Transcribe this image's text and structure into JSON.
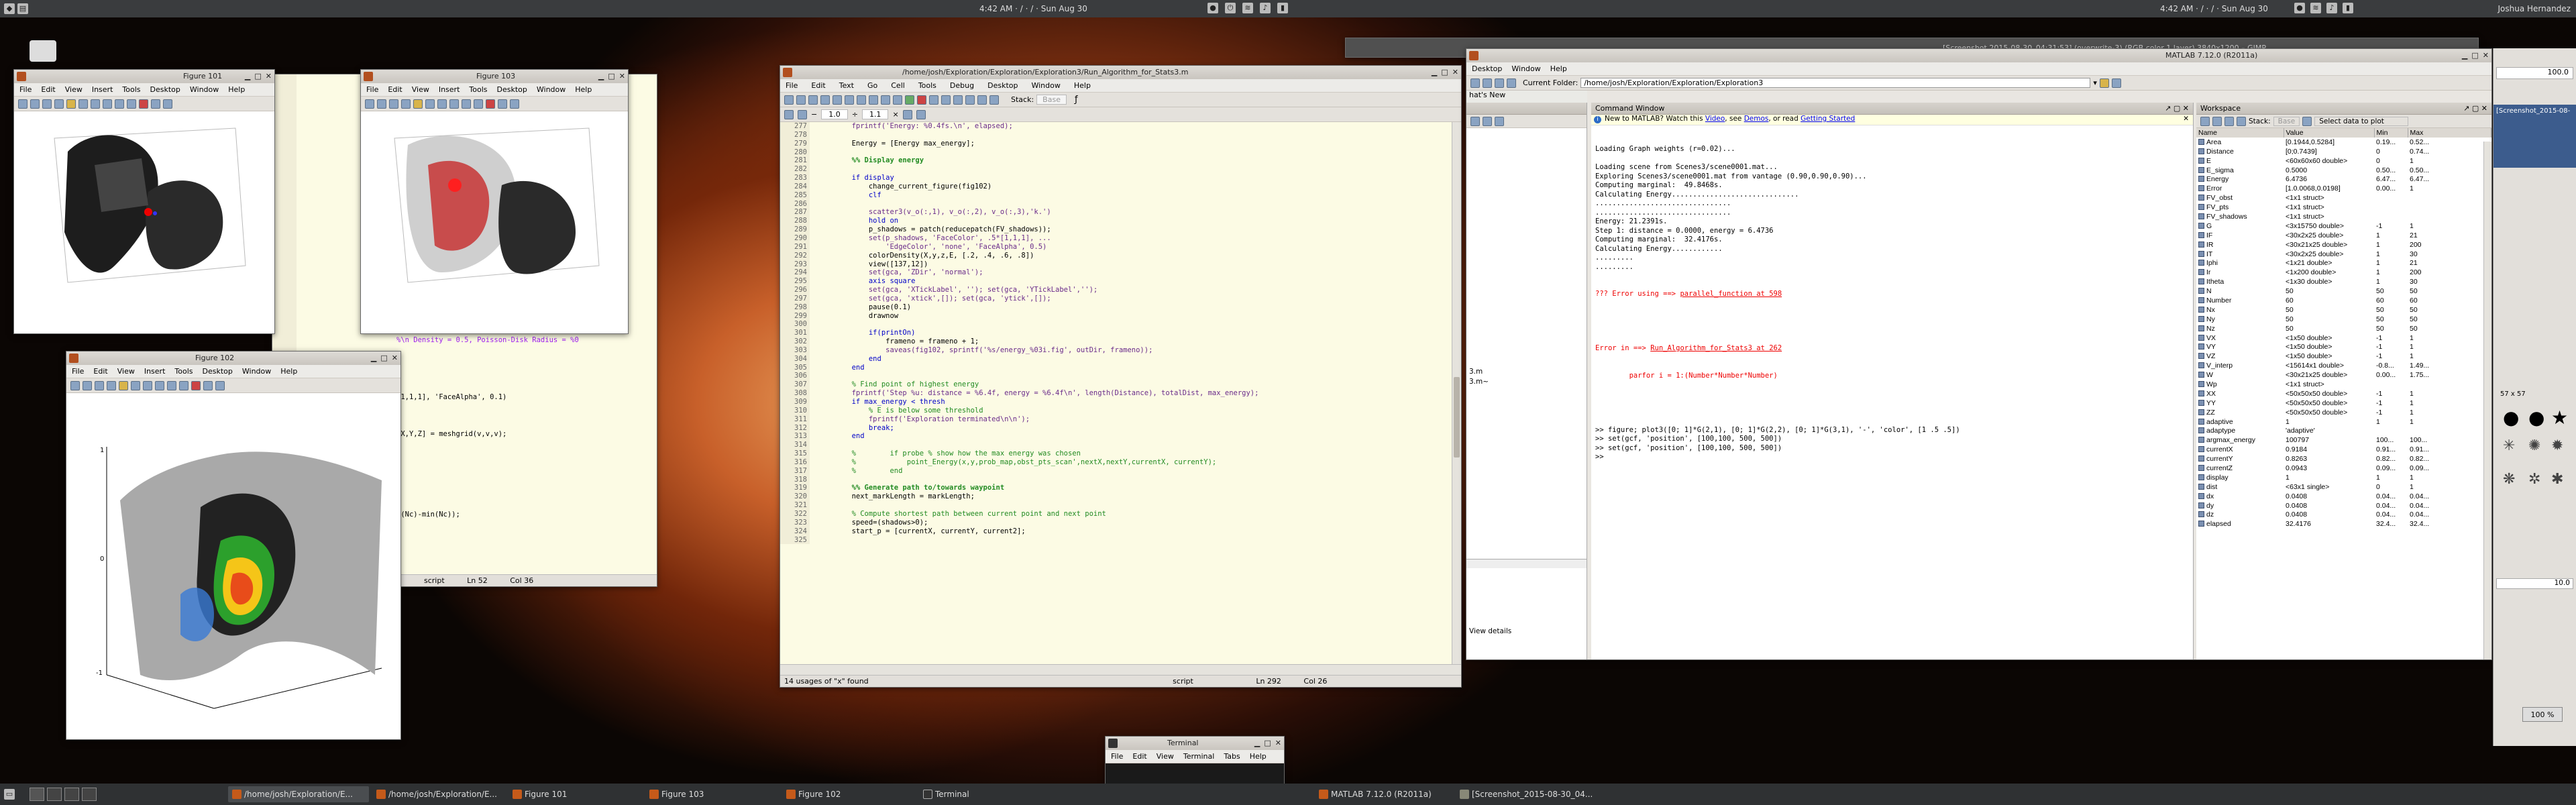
{
  "top_panel": {
    "clock_left": "4:42 AM · / · / · Sun Aug 30",
    "clock_right": "4:42 AM · / · / · Sun Aug 30",
    "user_name": "Joshua Hernandez"
  },
  "figure101": {
    "title": "Figure 101",
    "menu": [
      "File",
      "Edit",
      "View",
      "Insert",
      "Tools",
      "Desktop",
      "Window",
      "Help"
    ]
  },
  "figure103": {
    "title": "Figure 103",
    "menu": [
      "File",
      "Edit",
      "View",
      "Insert",
      "Tools",
      "Desktop",
      "Window",
      "Help"
    ]
  },
  "figure102": {
    "title": "Figure 102",
    "menu": [
      "File",
      "Edit",
      "View",
      "Insert",
      "Tools",
      "Desktop",
      "Window",
      "Help"
    ]
  },
  "editor_back": {
    "lines": [
      "%\\n Density = 0.5, Poisson-Disk Radius = %0",
      "[X,Y,Z] = meshgrid(v,v,v);",
      "[1,1,1], 'FaceAlpha', 0.1)",
      "x(Nc)-min(Nc));"
    ],
    "status_script": "script",
    "status_ln": "Ln  52",
    "status_col": "Col  36",
    "row_54": "54"
  },
  "editor": {
    "title": "/home/josh/Exploration/Exploration/Exploration3/Run_Algorithm_for_Stats3.m",
    "menu": [
      "File",
      "Edit",
      "Text",
      "Go",
      "Cell",
      "Tools",
      "Debug",
      "Desktop",
      "Window",
      "Help"
    ],
    "stack_label": "Stack:",
    "stack_value": "Base",
    "zoom_minus": "1.0",
    "zoom_plus": "1.1",
    "line_numbers": [
      "277",
      "278",
      "279",
      "280",
      "281",
      "282",
      "283",
      "284",
      "285",
      "286",
      "287",
      "288",
      "289",
      "290",
      "291",
      "292",
      "293",
      "294",
      "295",
      "296",
      "297",
      "298",
      "299",
      "300",
      "301",
      "302",
      "303",
      "304",
      "305",
      "306",
      "307",
      "308",
      "309",
      "310",
      "311",
      "312",
      "313",
      "314",
      "315",
      "316",
      "317",
      "318",
      "319",
      "320",
      "321",
      "322",
      "323",
      "324",
      "325"
    ],
    "code_lines": [
      "        fprintf('Energy: %0.4fs.\\n', elapsed);",
      "",
      "        Energy = [Energy max_energy];",
      "",
      "        %% Display energy",
      "",
      "        if display",
      "            change_current_figure(fig102)",
      "            clf",
      "",
      "            scatter3(v_o(:,1), v_o(:,2), v_o(:,3),'k.')",
      "            hold on",
      "            p_shadows = patch(reducepatch(FV_shadows));",
      "            set(p_shadows, 'FaceColor', .5*[1,1,1], ...",
      "                'EdgeColor', 'none', 'FaceAlpha', 0.5)",
      "            colorDensity(X,y,z,E, [.2, .4, .6, .8])",
      "            view([137,12])",
      "            set(gca, 'ZDir', 'normal');",
      "            axis square",
      "            set(gca, 'XTickLabel', ''); set(gca, 'YTickLabel','');",
      "            set(gca, 'xtick',[]); set(gca, 'ytick',[]);",
      "            pause(0.1)",
      "            drawnow",
      "",
      "            if(printOn)",
      "                frameno = frameno + 1;",
      "                saveas(fig102, sprintf('%s/energy_%03i.fig', outDir, frameno));",
      "            end",
      "        end",
      "",
      "        % Find point of highest energy",
      "        fprintf('Step %u: distance = %6.4f, energy = %6.4f\\n', length(Distance), totalDist, max_energy);",
      "        if max_energy < thresh",
      "            % E is below some threshold",
      "            fprintf('Exploration terminated\\n\\n');",
      "            break;",
      "        end",
      "",
      "        %        if probe % show how the max energy was chosen",
      "        %            point_Energy(x,y,prob_map,obst_pts_scan',nextX,nextY,currentX, currentY);",
      "        %        end",
      "",
      "        %% Generate path to/towards waypoint",
      "        next_markLength = markLength;",
      "",
      "        % Compute shortest path between current point and next point",
      "        speed=(shadows>0);",
      "        start_p = [currentX, currentY, current2];",
      ""
    ],
    "status_usage": "14 usages of \"x\" found",
    "status_script": "script",
    "status_ln": "Ln  292",
    "status_col": "Col  26"
  },
  "matlab": {
    "title": "MATLAB  7.12.0 (R2011a)",
    "menu": [
      "Desktop",
      "Window",
      "Help"
    ],
    "current_folder_label": "Current Folder:",
    "current_folder_value": "/home/josh/Exploration/Exploration/Exploration3",
    "whats_new": "hat's New",
    "cmd_window_title": "Command Window",
    "new_to_matlab_prefix": "New to MATLAB? Watch this ",
    "video_link": "Video",
    "see_text": ", see ",
    "demos_link": "Demos",
    "or_read": ", or read ",
    "getting_started_link": "Getting Started",
    "cmd_output": [
      "Loading Graph weights (r=0.02)...",
      "",
      "Loading scene from Scenes3/scene0001.mat...",
      "Exploring Scenes3/scene0001.mat from vantage (0.90,0.90,0.90)...",
      "Computing marginal:  49.8468s.",
      "Calculating Energy..............................",
      "................................",
      "................................",
      "Energy: 21.2391s.",
      "Step 1: distance = 0.0000, energy = 6.4736",
      "Computing marginal:  32.4176s.",
      "Calculating Energy............",
      ".........",
      "........."
    ],
    "err1_prefix": "??? Error using ==> ",
    "err1_link": "parallel_function at 598",
    "err2_prefix": "Error in ==> ",
    "err2_link": "Run_Algorithm_for_Stats3 at 262",
    "err2_code": "        parfor i = 1:(Number*Number*Number)",
    "cmd_after": [
      ">> figure; plot3([0; 1]*G(2,1), [0; 1]*G(2,2), [0; 1]*G(3,1), '-', 'color', [1 .5 .5])",
      ">> set(gcf, 'position', [100,100, 500, 500])",
      ">> set(gcf, 'position', [100,100, 500, 500])",
      ">>"
    ],
    "view_details": "View details",
    "side_items": [
      "3.m",
      "3.m~"
    ],
    "workspace_title": "Workspace",
    "workspace_toolbar": {
      "stack_label": "Stack:",
      "stack_value": "Base",
      "plot_select": "Select data to plot"
    },
    "workspace_columns": [
      "Name",
      "Value",
      "Min",
      "Max"
    ],
    "workspace_rows": [
      [
        "Area",
        "[0.1944,0.5284]",
        "0.19...",
        "0.52..."
      ],
      [
        "Distance",
        "[0;0.7439]",
        "0",
        "0.74..."
      ],
      [
        "E",
        "<60x60x60 double>",
        "0",
        "1"
      ],
      [
        "E_sigma",
        "0.5000",
        "0.50...",
        "0.50..."
      ],
      [
        "Energy",
        "6.4736",
        "6.47...",
        "6.47..."
      ],
      [
        "Error",
        "[1.0.0068,0.0198]",
        "0.00...",
        "1"
      ],
      [
        "FV_obst",
        "<1x1 struct>",
        "",
        ""
      ],
      [
        "FV_pts",
        "<1x1 struct>",
        "",
        ""
      ],
      [
        "FV_shadows",
        "<1x1 struct>",
        "",
        ""
      ],
      [
        "G",
        "<3x15750 double>",
        "-1",
        "1"
      ],
      [
        "IF",
        "<30x2x25 double>",
        "1",
        "21"
      ],
      [
        "IR",
        "<30x21x25 double>",
        "1",
        "200"
      ],
      [
        "IT",
        "<30x2x25 double>",
        "1",
        "30"
      ],
      [
        "Iphi",
        "<1x21 double>",
        "1",
        "21"
      ],
      [
        "Ir",
        "<1x200 double>",
        "1",
        "200"
      ],
      [
        "Itheta",
        "<1x30 double>",
        "1",
        "30"
      ],
      [
        "N",
        "50",
        "50",
        "50"
      ],
      [
        "Number",
        "60",
        "60",
        "60"
      ],
      [
        "Nx",
        "50",
        "50",
        "50"
      ],
      [
        "Ny",
        "50",
        "50",
        "50"
      ],
      [
        "Nz",
        "50",
        "50",
        "50"
      ],
      [
        "VX",
        "<1x50 double>",
        "-1",
        "1"
      ],
      [
        "VY",
        "<1x50 double>",
        "-1",
        "1"
      ],
      [
        "VZ",
        "<1x50 double>",
        "-1",
        "1"
      ],
      [
        "V_interp",
        "<15614x1 double>",
        "-0.8...",
        "1.49..."
      ],
      [
        "W",
        "<30x21x25 double>",
        "0.00...",
        "1.75..."
      ],
      [
        "Wp",
        "<1x1 struct>",
        "",
        ""
      ],
      [
        "XX",
        "<50x50x50 double>",
        "-1",
        "1"
      ],
      [
        "YY",
        "<50x50x50 double>",
        "-1",
        "1"
      ],
      [
        "ZZ",
        "<50x50x50 double>",
        "-1",
        "1"
      ],
      [
        "adaptive",
        "1",
        "1",
        "1"
      ],
      [
        "adaptype",
        "'adaptive'",
        "",
        ""
      ],
      [
        "argmax_energy",
        "100797",
        "100...",
        "100..."
      ],
      [
        "currentX",
        "0.9184",
        "0.91...",
        "0.91..."
      ],
      [
        "currentY",
        "0.8263",
        "0.82...",
        "0.82..."
      ],
      [
        "currentZ",
        "0.0943",
        "0.09...",
        "0.09..."
      ],
      [
        "display",
        "1",
        "1",
        "1"
      ],
      [
        "dist",
        "<63x1 single>",
        "0",
        "1"
      ],
      [
        "dx",
        "0.0408",
        "0.04...",
        "0.04..."
      ],
      [
        "dy",
        "0.0408",
        "0.04...",
        "0.04..."
      ],
      [
        "dz",
        "0.0408",
        "0.04...",
        "0.04..."
      ],
      [
        "elapsed",
        "32.4176",
        "32.4...",
        "32.4..."
      ]
    ]
  },
  "screenshot_window": {
    "title": "[Screenshot 2015-08-30_04:31:53] (overwrite-3) (RGB color 1 layer) 3840x1200 – GIMP",
    "thumb_label": "[Screenshot_2015-08-",
    "zoom_value": "100 %"
  },
  "gimp_right": {
    "value1": "100.0",
    "value2": "57 x 57",
    "value3": "10.0"
  },
  "terminal": {
    "title": "Terminal",
    "menu": [
      "File",
      "Edit",
      "View",
      "Terminal",
      "Tabs",
      "Help"
    ]
  },
  "taskbar": [
    {
      "label": "/home/josh/Exploration/E...",
      "active": true
    },
    {
      "label": "/home/josh/Exploration/E...",
      "active": false
    },
    {
      "label": "Figure 101",
      "active": false
    },
    {
      "label": "Figure 103",
      "active": false
    },
    {
      "label": "Figure 102",
      "active": false
    },
    {
      "label": "Terminal",
      "active": false
    },
    {
      "label": "MATLAB  7.12.0 (R2011a)",
      "active": false
    },
    {
      "label": "[Screenshot_2015-08-30_04...",
      "active": false
    }
  ]
}
